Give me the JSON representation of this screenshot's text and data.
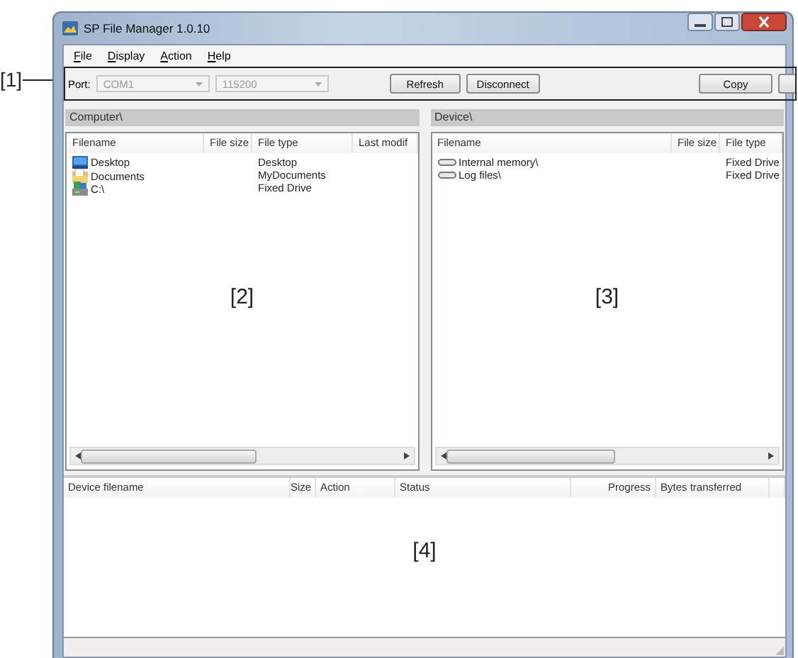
{
  "window": {
    "title": "SP File Manager 1.0.10"
  },
  "menu": [
    {
      "label": "File"
    },
    {
      "label": "Display"
    },
    {
      "label": "Action"
    },
    {
      "label": "Help"
    }
  ],
  "toolbar": {
    "callout": "[1]",
    "port_label": "Port:",
    "port": {
      "value": "COM1",
      "disabled": true
    },
    "baud": {
      "value": "115200",
      "disabled": true
    },
    "buttons": [
      {
        "label": "Refresh"
      },
      {
        "label": "Disconnect"
      },
      {
        "label": "Copy"
      }
    ]
  },
  "computer_pane": {
    "path": "Computer\\",
    "callout": "[2]",
    "columns": [
      "Filename",
      "File size",
      "File type",
      "Last modif"
    ],
    "rows": [
      {
        "kind": "desktop",
        "filename": "Desktop",
        "file_type": "Desktop"
      },
      {
        "kind": "documents",
        "filename": "Documents",
        "file_type": "MyDocuments"
      },
      {
        "kind": "drive",
        "filename": "C:\\",
        "file_type": "Fixed Drive"
      }
    ]
  },
  "device_pane": {
    "path": "Device\\",
    "callout": "[3]",
    "columns": [
      "Filename",
      "File size",
      "File type"
    ],
    "rows": [
      {
        "kind": "memory",
        "filename": "Internal memory\\",
        "file_type": "Fixed Drive"
      },
      {
        "kind": "memory",
        "filename": "Log files\\",
        "file_type": "Fixed Drive"
      }
    ]
  },
  "transfers": {
    "callout": "[4]",
    "columns": [
      "Device filename",
      "Size",
      "Action",
      "Status",
      "Progress",
      "Bytes transferred"
    ]
  }
}
